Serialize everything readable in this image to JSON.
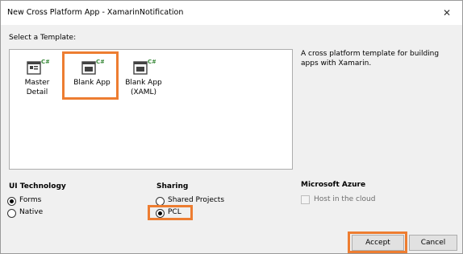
{
  "window": {
    "title": "New Cross Platform App - XamarinNotification",
    "close_glyph": "✕"
  },
  "templates": {
    "heading": "Select a Template:",
    "items": [
      {
        "label": "Master Detail",
        "icon": "master-detail-template-icon"
      },
      {
        "label": "Blank App",
        "icon": "blank-app-template-icon",
        "selected": true
      },
      {
        "label_line1": "Blank App",
        "label_line2": "(XAML)",
        "icon": "blank-app-xaml-template-icon"
      }
    ],
    "description": "A cross platform template for building apps with Xamarin.",
    "icon_badge": "C#"
  },
  "ui_technology": {
    "heading": "UI Technology",
    "options": [
      {
        "label": "Forms",
        "checked": true
      },
      {
        "label": "Native",
        "checked": false
      }
    ]
  },
  "sharing": {
    "heading": "Sharing",
    "options": [
      {
        "label": "Shared Projects",
        "checked": false
      },
      {
        "label": "PCL",
        "checked": true
      }
    ]
  },
  "azure": {
    "heading": "Microsoft Azure",
    "host_label": "Host in the cloud",
    "host_checked": false,
    "enabled": false
  },
  "buttons": {
    "accept": "Accept",
    "cancel": "Cancel"
  },
  "colors": {
    "highlight": "#ed7d31",
    "icon_green": "#3a8a3a"
  }
}
